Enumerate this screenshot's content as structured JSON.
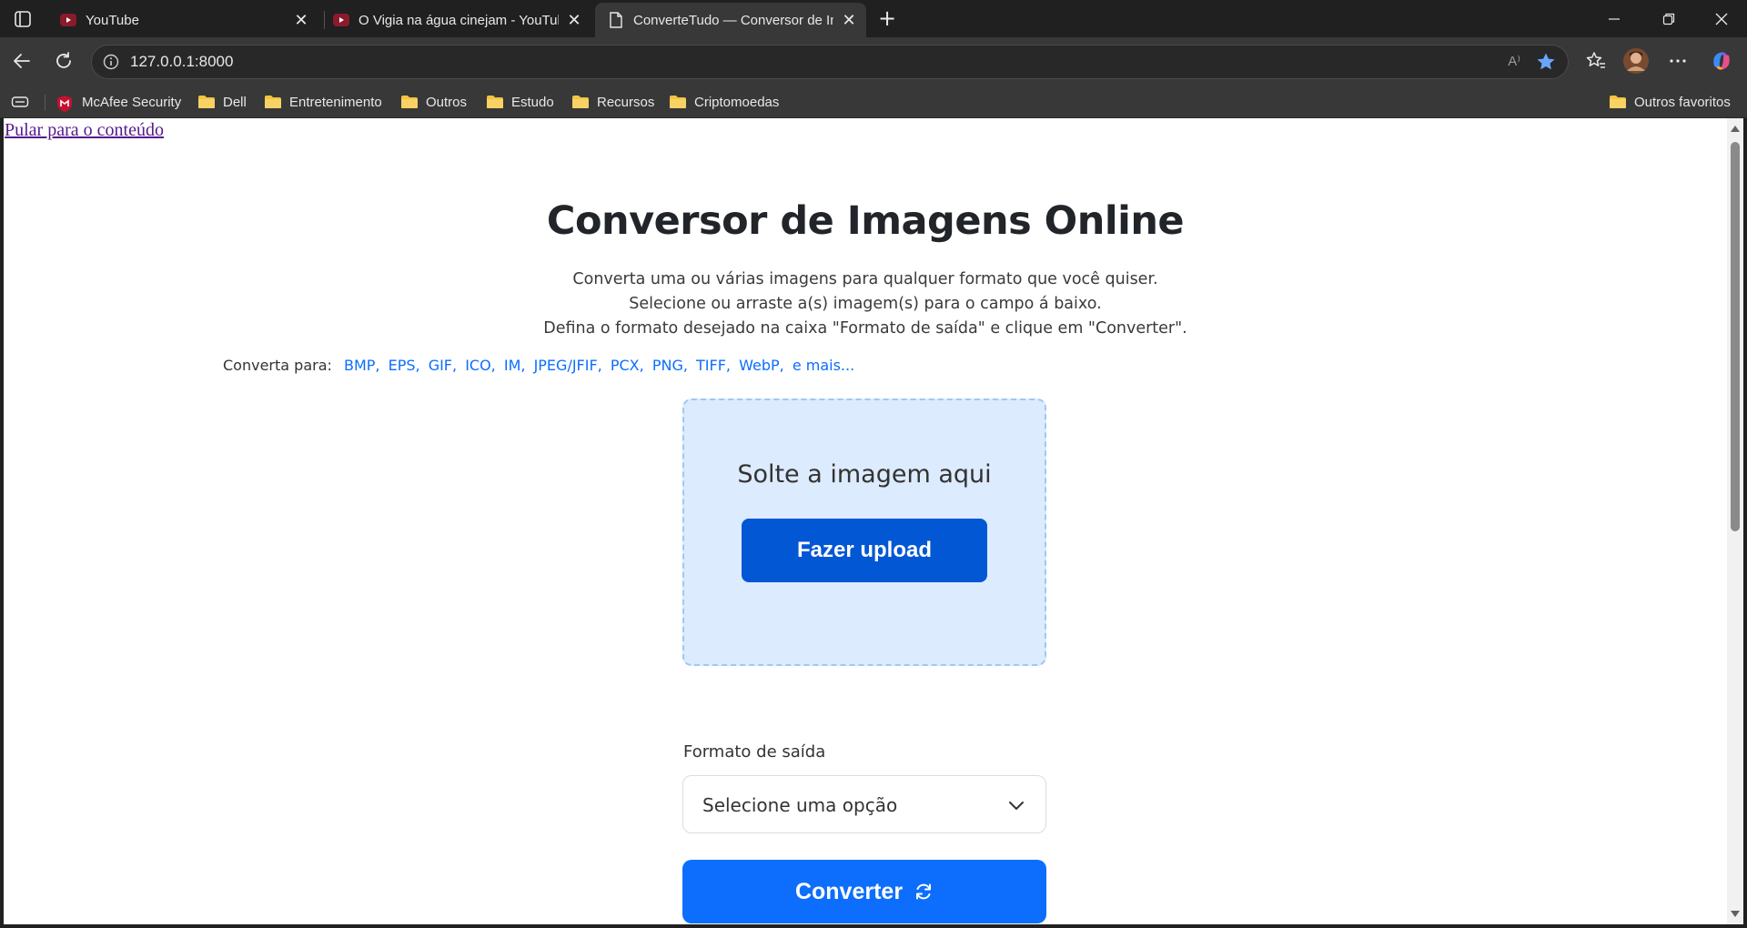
{
  "browser": {
    "tabs": [
      {
        "title": "YouTube",
        "icon": "youtube-icon",
        "active": false
      },
      {
        "title": "O Vigia na água cinejam - YouTube",
        "icon": "youtube-icon",
        "active": false
      },
      {
        "title": "ConverteTudo — Conversor de Imagens",
        "icon": "page-icon",
        "active": true
      }
    ],
    "address": "127.0.0.1:8000",
    "read_aloud": "A⁾",
    "bookmarks": [
      {
        "label": "McAfee Security",
        "icon": "mcafee-icon"
      },
      {
        "label": "Dell",
        "icon": "folder-icon"
      },
      {
        "label": "Entretenimento",
        "icon": "folder-icon"
      },
      {
        "label": "Outros",
        "icon": "folder-icon"
      },
      {
        "label": "Estudo",
        "icon": "folder-icon"
      },
      {
        "label": "Recursos",
        "icon": "folder-icon"
      },
      {
        "label": "Criptomoedas",
        "icon": "folder-icon"
      }
    ],
    "other_favorites": "Outros favoritos",
    "colors": {
      "chrome_dark": "#202020",
      "toolbar": "#383838",
      "folder": "#f5c342",
      "youtube_red": "#d0021b"
    }
  },
  "page": {
    "skip_link": "Pular para o conteúdo",
    "title": "Conversor de Imagens Online",
    "intro": [
      "Converta uma ou várias imagens para qualquer formato que você quiser.",
      "Selecione ou arraste a(s) imagem(s) para o campo á baixo.",
      "Defina o formato desejado na caixa \"Formato de saída\" e clique em \"Converter\"."
    ],
    "convert_to_label": "Converta para:",
    "formats": [
      "BMP,",
      "EPS,",
      "GIF,",
      "ICO,",
      "IM,",
      "JPEG/JFIF,",
      "PCX,",
      "PNG,",
      "TIFF,",
      "WebP,",
      "e mais..."
    ],
    "dropzone": {
      "text": "Solte a imagem aqui",
      "upload_button": "Fazer upload"
    },
    "output": {
      "label": "Formato de saída",
      "selected": "Selecione uma opção"
    },
    "convert_button": "Converter",
    "colors": {
      "primary": "#0d6efd",
      "upload": "#0257d4",
      "dropzone_bg": "#dcebfd",
      "link": "#0d6efd",
      "skip_link": "#551a8b"
    }
  }
}
